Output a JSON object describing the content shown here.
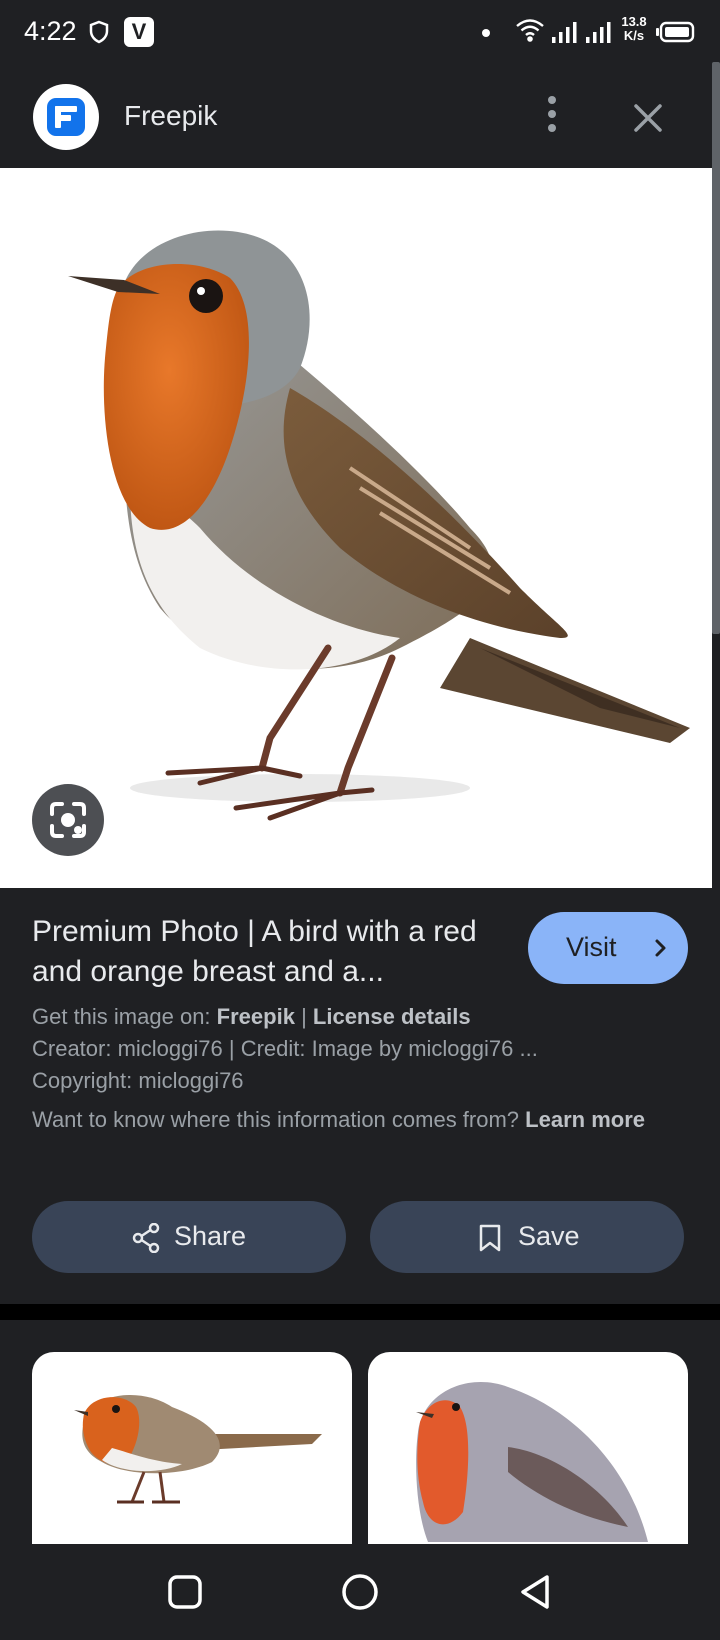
{
  "status_bar": {
    "time": "4:22",
    "speed_value": "13.8",
    "speed_unit": "K/s",
    "icons": [
      "shield-icon",
      "v-app-icon",
      "dot-icon",
      "wifi-icon",
      "signal-icon",
      "signal-icon",
      "battery-icon"
    ]
  },
  "app_bar": {
    "source_name": "Freepik",
    "icons": [
      "freepik-logo",
      "more-vert-icon",
      "close-icon"
    ]
  },
  "main_image": {
    "subject": "robin-bird-photo",
    "lens_icon": "lens-icon"
  },
  "info": {
    "title": "Premium Photo | A bird with a red and orange breast and a...",
    "visit_label": "Visit",
    "get_image_prefix": "Get this image on:",
    "get_image_source": "Freepik",
    "separator": "|",
    "license_link": "License details",
    "creator_line": "Creator: micloggi76 | Credit: Image by micloggi76 ...",
    "copyright_line": "Copyright: micloggi76",
    "learn_prefix": "Want to know where this information comes from?",
    "learn_link": "Learn more",
    "share_label": "Share",
    "save_label": "Save"
  },
  "related": {
    "items": [
      "robin-thumbnail-1",
      "robin-thumbnail-2"
    ]
  },
  "nav_bar": {
    "buttons": [
      "recents-icon",
      "home-icon",
      "back-icon"
    ]
  },
  "colors": {
    "background": "#1f2023",
    "accent_button": "#8ab4f8",
    "action_button": "#394457",
    "robin_orange": "#d2631c"
  }
}
